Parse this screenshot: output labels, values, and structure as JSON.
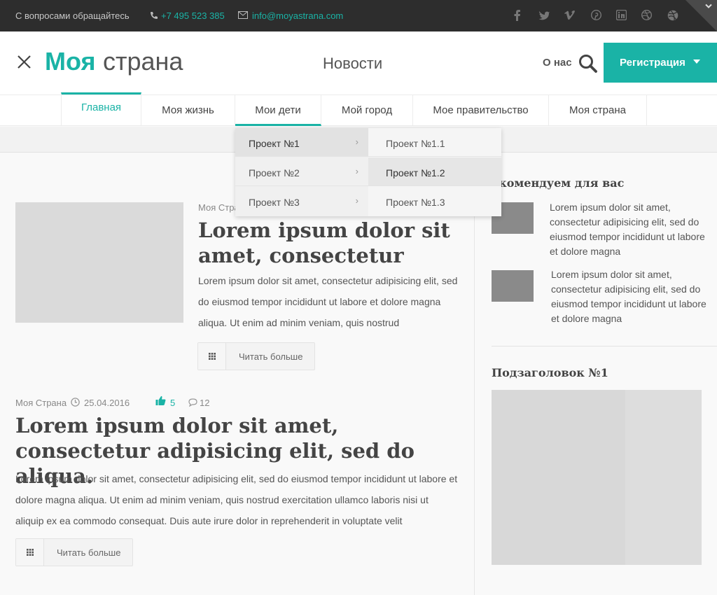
{
  "topbar": {
    "contact_label": "С вопросами обращайтесь",
    "phone": "+7 495 523 385",
    "email": "info@moyastrana.com",
    "social_icons": [
      "facebook-icon",
      "twitter-icon",
      "vimeo-icon",
      "pinterest-icon",
      "linkedin-icon",
      "dribbble-icon",
      "dribbble-alt-icon"
    ],
    "accent": "#1ab3a6"
  },
  "header": {
    "logo_bold": "Моя",
    "logo_thin": "страна",
    "news_link": "Новости",
    "about_link": "О нас",
    "register_button": "Регистрация"
  },
  "nav": {
    "items": [
      "Главная",
      "Моя жизнь",
      "Мои дети",
      "Мой город",
      "Мое правительство",
      "Моя страна"
    ],
    "active": "Главная",
    "open": "Мои дети"
  },
  "dropdown": {
    "level1": [
      "Проект №1",
      "Проект №2",
      "Проект №3"
    ],
    "level2": [
      "Проект №1.1",
      "Проект №1.2",
      "Проект №1.3"
    ]
  },
  "post1": {
    "author": "Моя Стра",
    "title": "Lorem ipsum dolor sit amet, consectetur",
    "excerpt": "Lorem ipsum dolor sit amet, consectetur adipisicing elit, sed do eiusmod tempor incididunt ut labore et dolore magna aliqua. Ut enim ad minim veniam, quis nostrud",
    "read_more": "Читать больше"
  },
  "post2": {
    "author": "Моя Страна",
    "date": "25.04.2016",
    "likes": "5",
    "comments": "12",
    "title": "Lorem ipsum dolor sit amet, consectetur adipisicing elit, sed do aliqua.",
    "excerpt": "Lorem ipsum dolor sit amet, consectetur adipisicing elit, sed do eiusmod tempor incididunt ut labore et dolore magna aliqua. Ut enim ad minim veniam, quis nostrud exercitation ullamco laboris nisi ut aliquip ex ea commodo consequat. Duis aute irure dolor in reprehenderit in voluptate velit",
    "read_more": "Читать больше"
  },
  "sidebar": {
    "recommended_title": "екомендуем для вас",
    "items": [
      "Lorem ipsum dolor sit amet, consectetur adipisicing elit, sed do eiusmod tempor incididunt ut labore et dolore magna",
      "Lorem ipsum dolor sit amet, consectetur adipisicing elit, sed do eiusmod tempor incididunt ut labore et dolore magna"
    ],
    "subheading": "Подзаголовок №1"
  }
}
